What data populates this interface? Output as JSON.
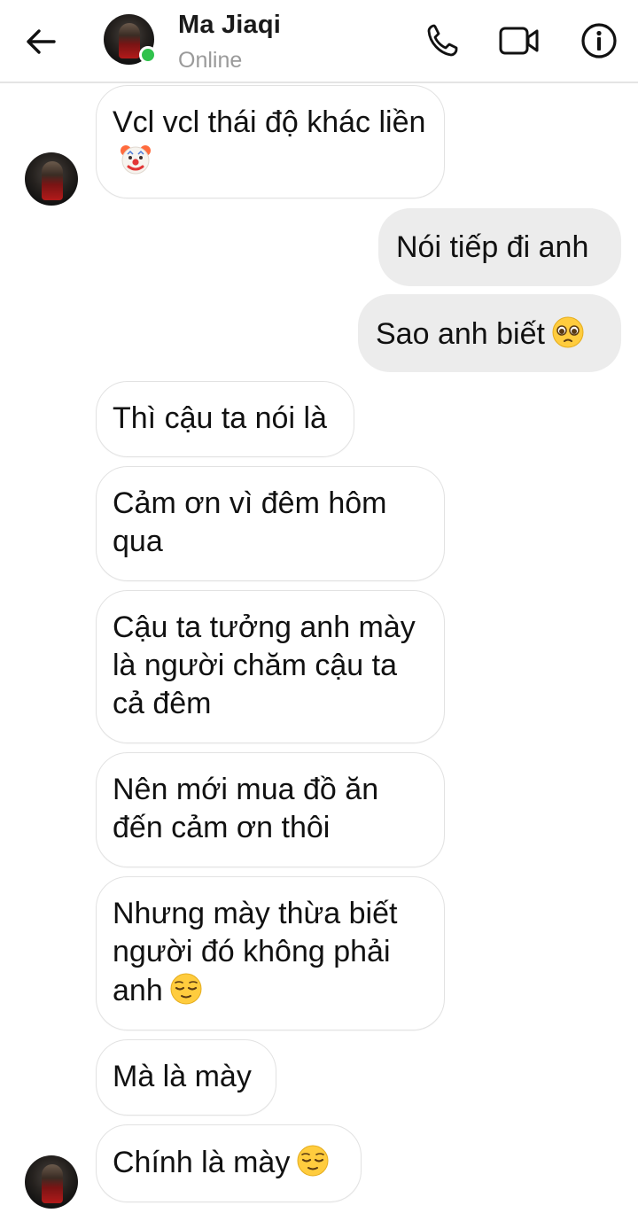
{
  "header": {
    "contact_name": "Ma Jiaqi",
    "status": "Online",
    "icons": {
      "back": "arrow-left-icon",
      "call": "phone-icon",
      "video": "video-camera-icon",
      "info": "info-icon"
    },
    "colors": {
      "online": "#31c24d"
    }
  },
  "messages": [
    {
      "direction": "incoming",
      "text": "Vcl vcl thái độ khác liền",
      "emoji": "clown-face"
    },
    {
      "direction": "outgoing",
      "text": "Nói tiếp đi anh"
    },
    {
      "direction": "outgoing",
      "text": "Sao anh biết",
      "emoji": "pleading-face"
    },
    {
      "direction": "incoming",
      "text": "Thì cậu ta nói là"
    },
    {
      "direction": "incoming",
      "text": "Cảm ơn vì đêm hôm qua"
    },
    {
      "direction": "incoming",
      "text": "Cậu ta tưởng anh mày là người chăm cậu ta cả đêm"
    },
    {
      "direction": "incoming",
      "text": "Nên mới mua đồ ăn đến cảm ơn thôi"
    },
    {
      "direction": "incoming",
      "text": "Nhưng mày thừa biết người đó không phải anh",
      "emoji": "relieved-face"
    },
    {
      "direction": "incoming",
      "text": "Mà là mày"
    },
    {
      "direction": "incoming",
      "text": "Chính là mày",
      "emoji": "relieved-face"
    }
  ],
  "colors": {
    "outgoing_bubble": "#ececec",
    "incoming_border": "#e2e2e2"
  }
}
